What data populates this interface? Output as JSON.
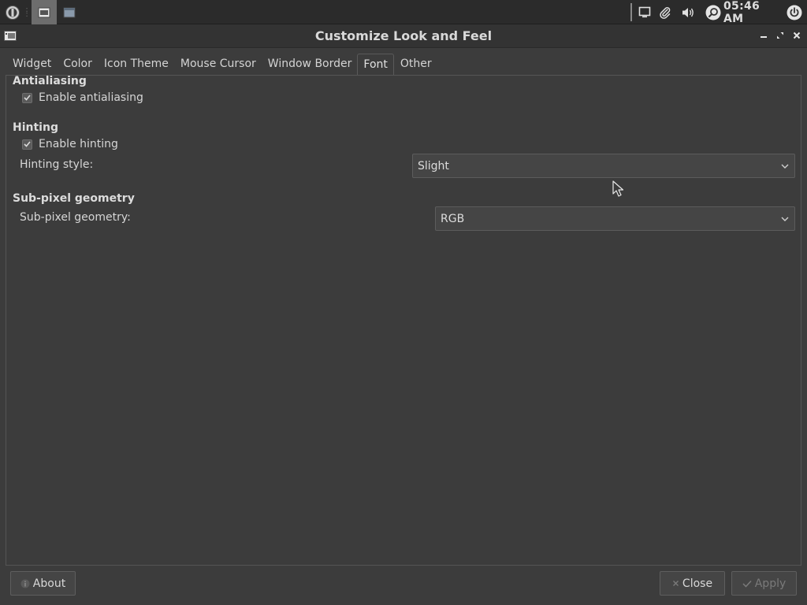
{
  "taskbar": {
    "clock": "05:46 AM",
    "icons": [
      "app-menu-icon",
      "window-task-icon",
      "window-task-icon",
      "screen-icon",
      "paperclip-icon",
      "volume-icon",
      "search-icon",
      "power-icon"
    ]
  },
  "window": {
    "title": "Customize Look and Feel"
  },
  "tabs": [
    {
      "label": "Widget"
    },
    {
      "label": "Color"
    },
    {
      "label": "Icon Theme"
    },
    {
      "label": "Mouse Cursor"
    },
    {
      "label": "Window Border"
    },
    {
      "label": "Font",
      "active": true
    },
    {
      "label": "Other"
    }
  ],
  "antialiasing": {
    "title": "Antialiasing",
    "enable_label": "Enable antialiasing",
    "enabled": true
  },
  "hinting": {
    "title": "Hinting",
    "enable_label": "Enable hinting",
    "enabled": true,
    "style_label": "Hinting style:",
    "style_value": "Slight"
  },
  "subpixel": {
    "title": "Sub-pixel geometry",
    "geometry_label": "Sub-pixel geometry:",
    "geometry_value": "RGB"
  },
  "buttons": {
    "about": "About",
    "close": "Close",
    "apply": "Apply"
  },
  "colors": {
    "background": "#3c3c3c",
    "taskbar": "#2b2b2b",
    "text": "#d6d6d6"
  }
}
